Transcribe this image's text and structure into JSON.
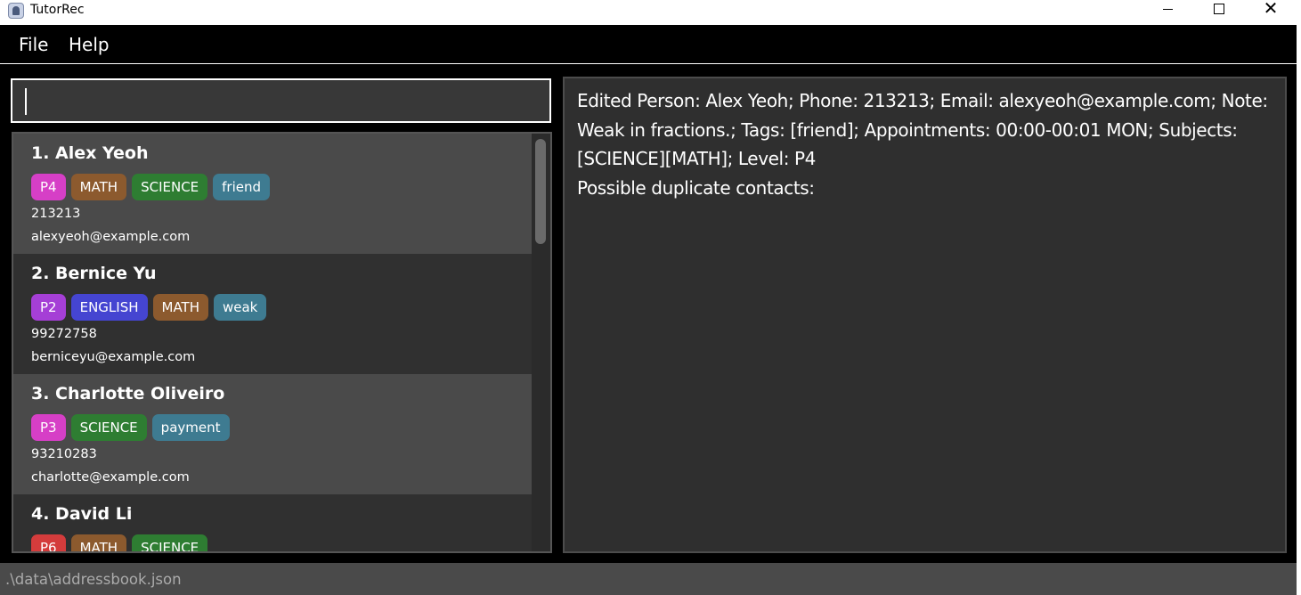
{
  "window": {
    "title": "TutorRec",
    "minimize_icon": "minimize-icon",
    "maximize_icon": "maximize-icon",
    "close_icon": "close-icon",
    "close_glyph": "✕"
  },
  "menu": {
    "items": [
      {
        "label": "File"
      },
      {
        "label": "Help"
      }
    ]
  },
  "command_box": {
    "value": ""
  },
  "person_list": {
    "persons": [
      {
        "name": "1.  Alex Yeoh",
        "tags": [
          {
            "label": "P4",
            "color": "#d63fc6"
          },
          {
            "label": "MATH",
            "color": "#8c5a2e"
          },
          {
            "label": "SCIENCE",
            "color": "#2e7d32"
          },
          {
            "label": "friend",
            "color": "#3e7b91"
          }
        ],
        "phone": "213213",
        "email": "alexyeoh@example.com"
      },
      {
        "name": "2.  Bernice Yu",
        "tags": [
          {
            "label": "P2",
            "color": "#a53fd6"
          },
          {
            "label": "ENGLISH",
            "color": "#4545d1"
          },
          {
            "label": "MATH",
            "color": "#8c5a2e"
          },
          {
            "label": "weak",
            "color": "#3e7b91"
          }
        ],
        "phone": "99272758",
        "email": "berniceyu@example.com"
      },
      {
        "name": "3.  Charlotte Oliveiro",
        "tags": [
          {
            "label": "P3",
            "color": "#d63fc6"
          },
          {
            "label": "SCIENCE",
            "color": "#2e7d32"
          },
          {
            "label": "payment",
            "color": "#3e7b91"
          }
        ],
        "phone": "93210283",
        "email": "charlotte@example.com"
      },
      {
        "name": "4.  David Li",
        "tags": [
          {
            "label": "P6",
            "color": "#d43c3c"
          },
          {
            "label": "MATH",
            "color": "#8c5a2e"
          },
          {
            "label": "SCIENCE",
            "color": "#2e7d32"
          }
        ],
        "phone": "",
        "email": ""
      }
    ]
  },
  "result_display": {
    "text": "Edited Person: Alex Yeoh; Phone: 213213; Email: alexyeoh@example.com; Note: Weak in fractions.; Tags: [friend]; Appointments: 00:00-00:01 MON; Subjects: [SCIENCE][MATH]; Level: P4\nPossible duplicate contacts:"
  },
  "status_bar": {
    "file_path": ".\\data\\addressbook.json"
  }
}
